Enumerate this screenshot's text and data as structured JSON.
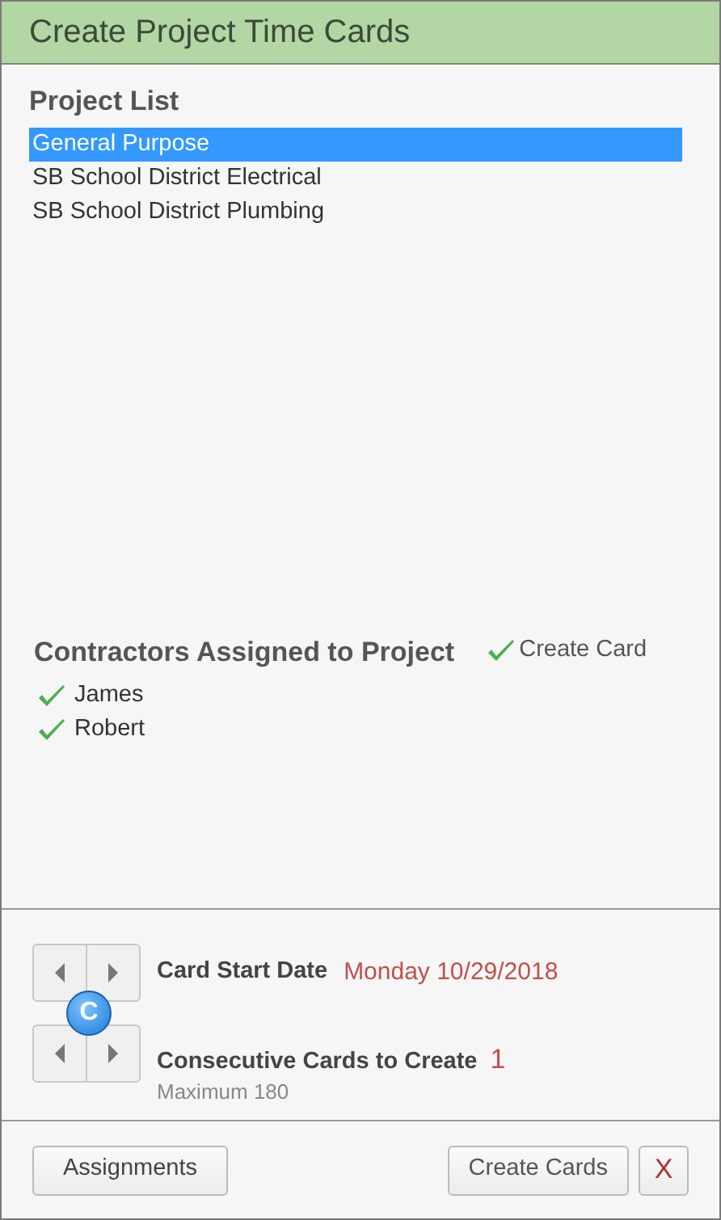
{
  "window": {
    "title": "Create Project Time Cards"
  },
  "project_list": {
    "heading": "Project List",
    "items": [
      {
        "label": "General Purpose",
        "selected": true
      },
      {
        "label": "SB School District Electrical",
        "selected": false
      },
      {
        "label": "SB School District Plumbing",
        "selected": false
      }
    ]
  },
  "contractors": {
    "heading": "Contractors Assigned to Project",
    "create_card": {
      "label": "Create Card",
      "checked": true
    },
    "items": [
      {
        "name": "James",
        "checked": true
      },
      {
        "name": "Robert",
        "checked": true
      }
    ]
  },
  "settings": {
    "start_date": {
      "label": "Card Start Date",
      "day": "Monday",
      "date": "10/29/2018"
    },
    "badge": "C",
    "consecutive": {
      "label": "Consecutive Cards to Create",
      "value": "1",
      "hint": "Maximum 180"
    }
  },
  "buttons": {
    "assignments": "Assignments",
    "create": "Create Cards",
    "close": "X"
  }
}
